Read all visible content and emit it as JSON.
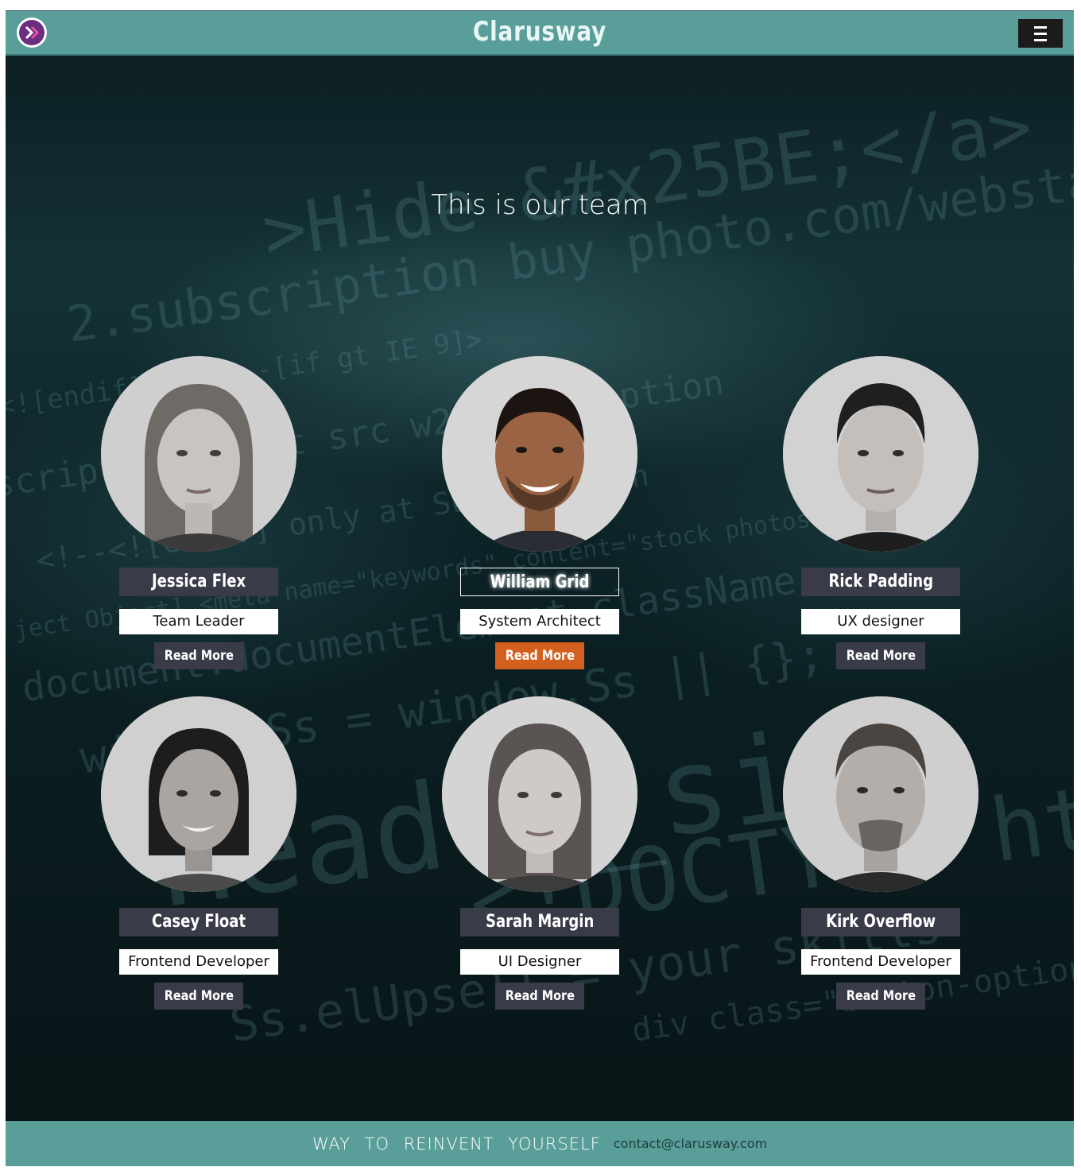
{
  "header": {
    "brand": "Clarusway",
    "logo_icon": "chevron-double-right-icon",
    "menu_icon": "hamburger-icon"
  },
  "main": {
    "heading": "This is our team"
  },
  "team": [
    {
      "name": "Jessica Flex",
      "role": "Team Leader",
      "button": "Read More",
      "avatar": "female-portrait-icon"
    },
    {
      "name": "William Grid",
      "role": "System Architect",
      "button": "Read More",
      "avatar": "male-portrait-icon"
    },
    {
      "name": "Rick Padding",
      "role": "UX designer",
      "button": "Read More",
      "avatar": "male-portrait-icon"
    },
    {
      "name": "Casey Float",
      "role": "Frontend Developer",
      "button": "Read More",
      "avatar": "female-portrait-icon"
    },
    {
      "name": "Sarah Margin",
      "role": "UI Designer",
      "button": "Read More",
      "avatar": "female-portrait-icon"
    },
    {
      "name": "Kirk Overflow",
      "role": "Frontend Developer",
      "button": "Read More",
      "avatar": "male-portrait-icon"
    }
  ],
  "footer": {
    "slogan": "WAY TO REINVENT YOURSELF",
    "contact": "contact@clarusway.com"
  },
  "colors": {
    "header": "#5a9e9a",
    "name_box": "#3a3b49",
    "button": "#3a3b49",
    "button_active": "#d4601f",
    "logo": "#6b2e7f"
  }
}
